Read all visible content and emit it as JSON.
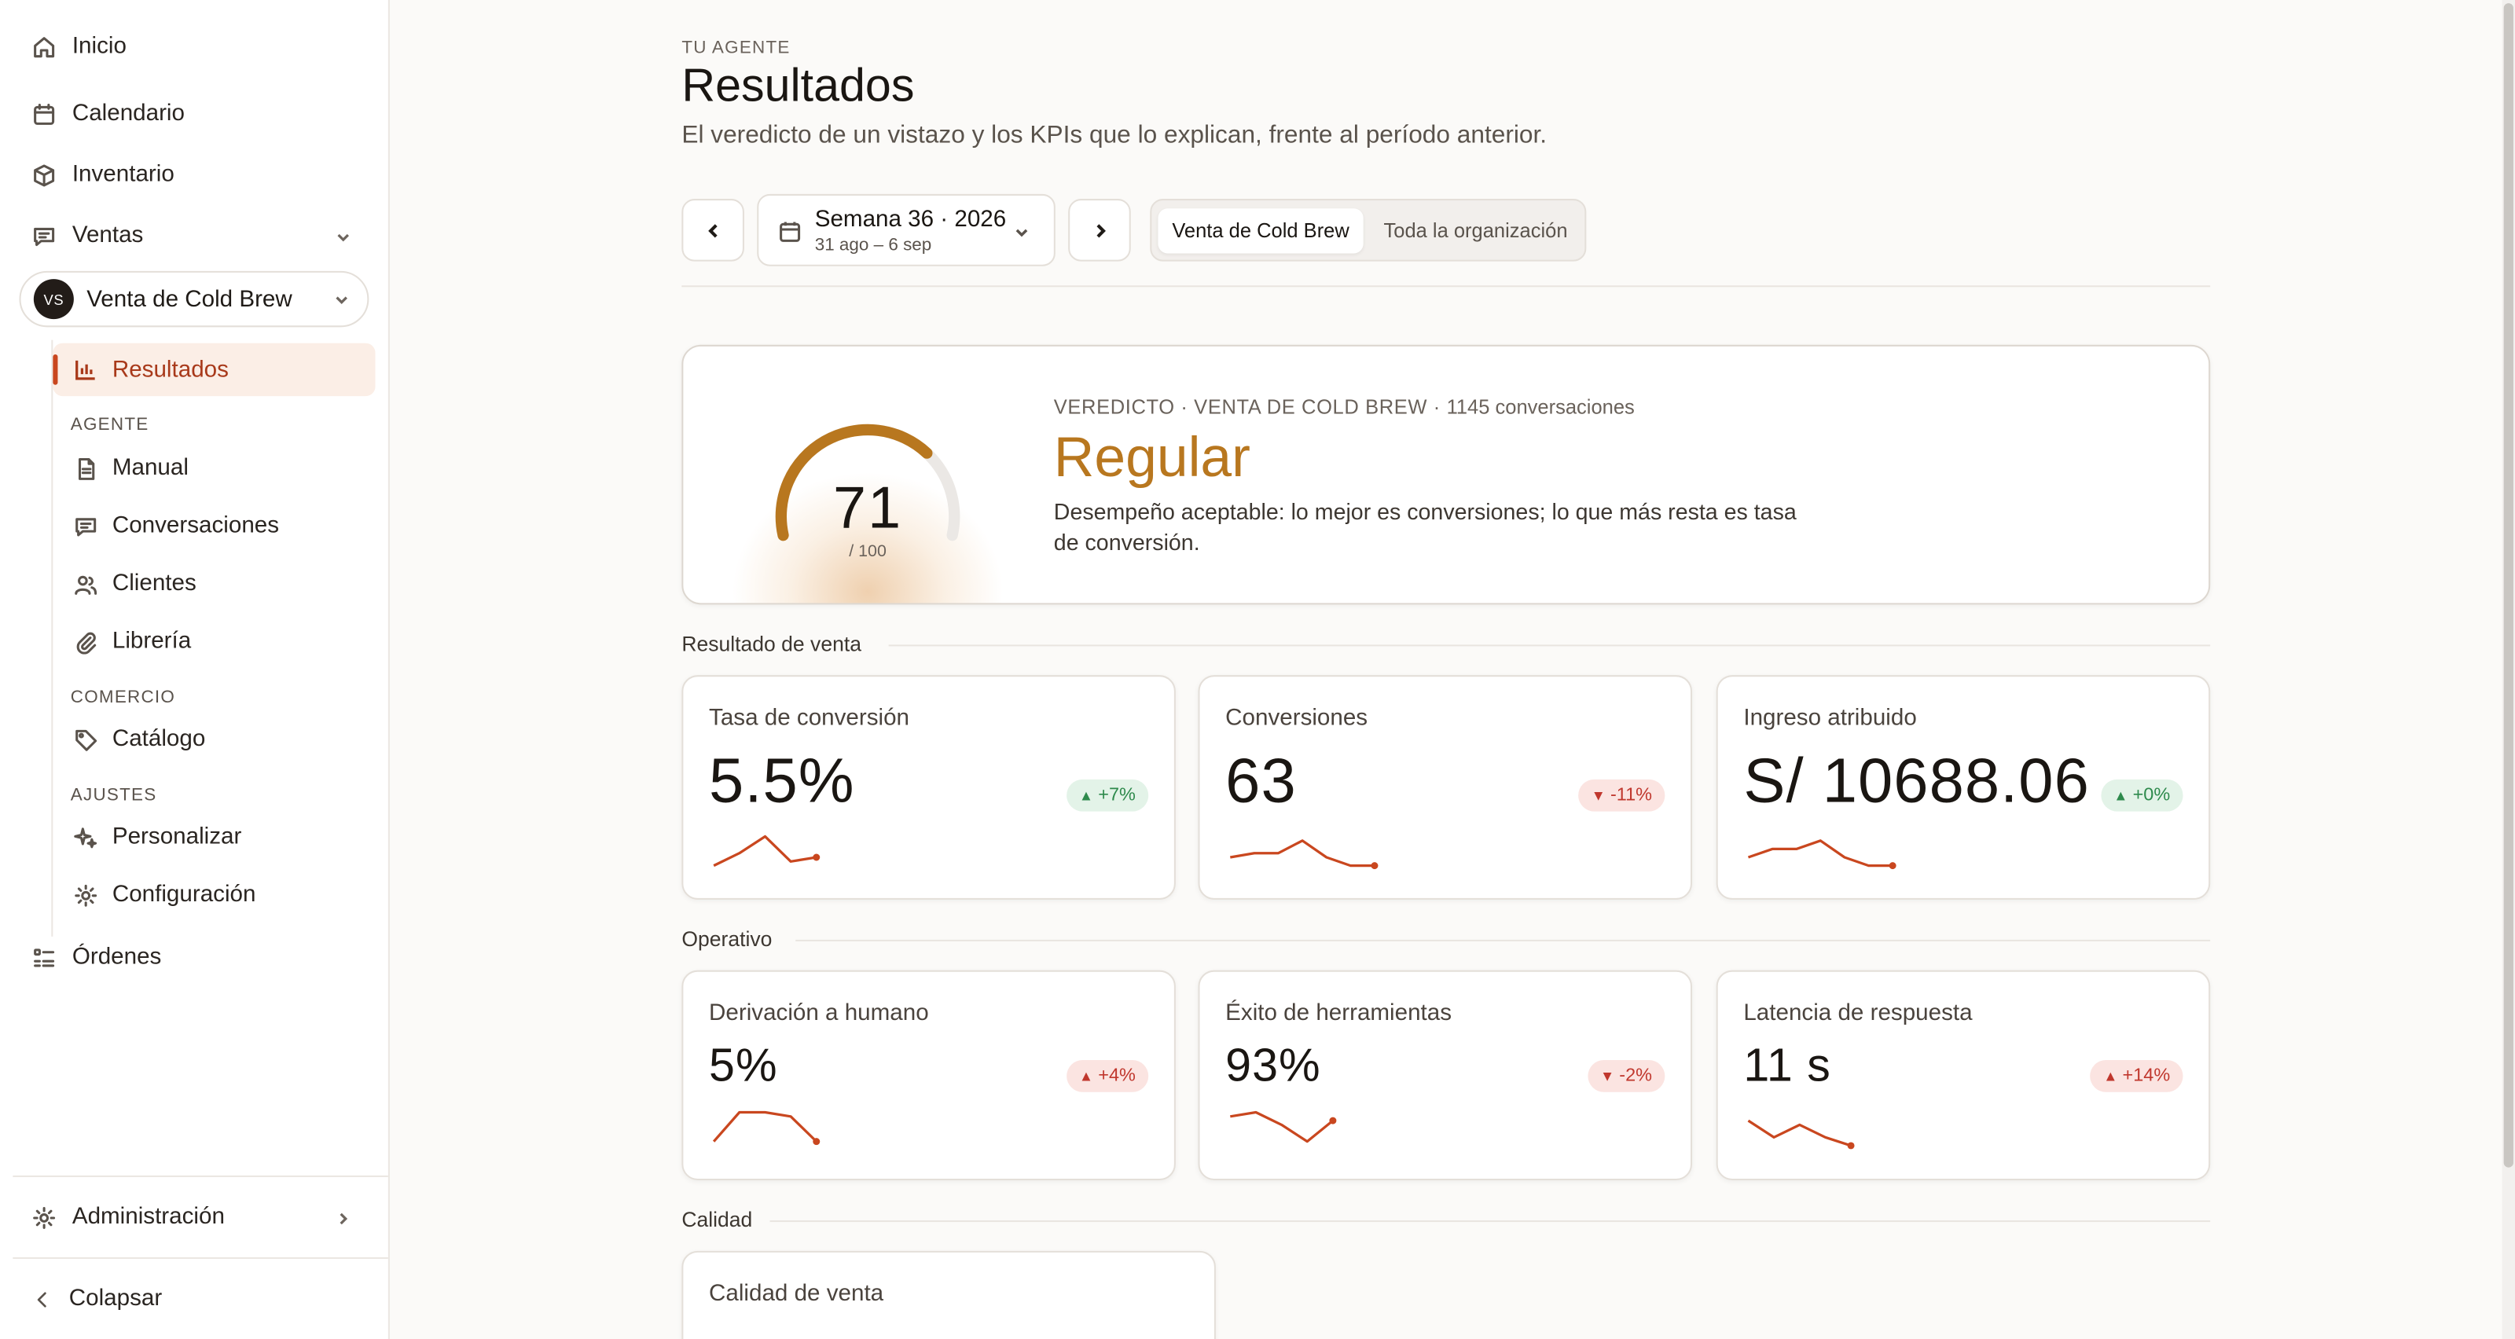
{
  "sidebar": {
    "inicio": "Inicio",
    "calendario": "Calendario",
    "inventario": "Inventario",
    "ventas": "Ventas",
    "agent": {
      "initials": "VS",
      "name": "Venta de Cold Brew"
    },
    "resultados": "Resultados",
    "section_agente": "AGENTE",
    "manual": "Manual",
    "conversaciones": "Conversaciones",
    "clientes": "Clientes",
    "libreria": "Librería",
    "section_comercio": "COMERCIO",
    "catalogo": "Catálogo",
    "section_ajustes": "AJUSTES",
    "personalizar": "Personalizar",
    "configuracion": "Configuración",
    "ordenes": "Órdenes",
    "administracion": "Administración",
    "colapsar": "Colapsar"
  },
  "header": {
    "eyebrow": "TU AGENTE",
    "title": "Resultados",
    "subtitle": "El veredicto de un vistazo y los KPIs que lo explican, frente al período anterior."
  },
  "period": {
    "week": "Semana 36 · 2026",
    "range": "31 ago – 6 sep"
  },
  "scope": {
    "selected": "Venta de Cold Brew",
    "other": "Toda la organización"
  },
  "verdict": {
    "meta": "VEREDICTO · VENTA DE COLD BREW · ",
    "conversations": "1145 conversaciones",
    "score": "71",
    "score_max": "/ 100",
    "score_value": 71,
    "word": "Regular",
    "description": "Desempeño aceptable: lo mejor es conversiones; lo que más resta es tasa de conversión.",
    "accent": "#b8771f"
  },
  "groups": {
    "venta": "Resultado de venta",
    "operativo": "Operativo",
    "calidad": "Calidad"
  },
  "kpis": {
    "tasa": {
      "label": "Tasa de conversión",
      "value": "5.5%",
      "delta": "+7%",
      "trend": "good",
      "spark": [
        2,
        5,
        9,
        3,
        4
      ]
    },
    "conv": {
      "label": "Conversiones",
      "value": "63",
      "delta": "-11%",
      "trend": "bad",
      "spark": [
        4,
        5,
        5,
        8,
        4,
        2,
        2
      ]
    },
    "ingreso": {
      "label": "Ingreso atribuido",
      "value": "S/ 10688.06",
      "delta": "+0%",
      "trend": "good",
      "spark": [
        4,
        6,
        6,
        8,
        4,
        2,
        2
      ]
    },
    "derivacion": {
      "label": "Derivación a humano",
      "value": "5%",
      "delta": "+4%",
      "trend": "bad",
      "spark": [
        2,
        9,
        9,
        8,
        2
      ]
    },
    "exito": {
      "label": "Éxito de herramientas",
      "value": "93%",
      "delta": "-2%",
      "trend": "bad",
      "spark": [
        8,
        9,
        6,
        2,
        7
      ]
    },
    "latencia": {
      "label": "Latencia de respuesta",
      "value": "11 s",
      "delta": "+14%",
      "trend": "bad",
      "spark": [
        7,
        3,
        6,
        3,
        1
      ]
    },
    "calidad": {
      "label": "Calidad de venta"
    }
  },
  "colors": {
    "up_good": "#2e8a4c",
    "down_bad": "#c0372d",
    "spark": "#c9471f"
  }
}
